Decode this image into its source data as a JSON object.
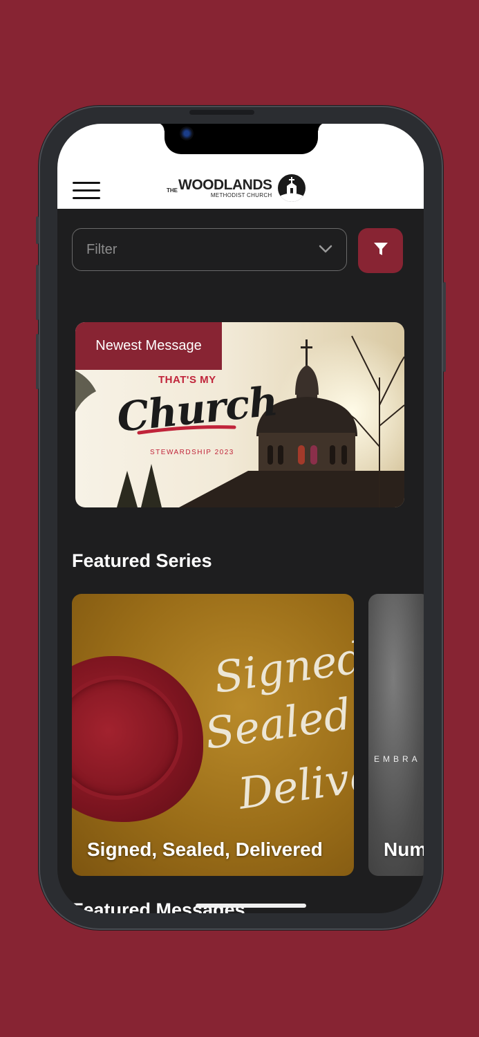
{
  "header": {
    "logo_prefix": "THE",
    "logo_name": "WOODLANDS",
    "logo_subtitle": "METHODIST CHURCH"
  },
  "filter": {
    "placeholder": "Filter"
  },
  "newest_message": {
    "badge": "Newest Message",
    "art_title_top": "THAT'S MY",
    "art_title_main": "Church",
    "art_subtitle": "STEWARDSHIP 2023"
  },
  "featured_series": {
    "title": "Featured Series",
    "items": [
      {
        "label": "Signed, Sealed, Delivered",
        "art_lines": [
          "Signed",
          "Sealed,",
          "Delivered"
        ]
      },
      {
        "label": "Num",
        "art_text": "EMBRA"
      }
    ]
  },
  "featured_messages": {
    "title": "Featured Messages"
  },
  "colors": {
    "background": "#872433",
    "accent": "#882433",
    "screen": "#1e1e1f"
  },
  "icons": [
    "menu-icon",
    "chevron-down-icon",
    "filter-icon",
    "church-logo-icon"
  ]
}
